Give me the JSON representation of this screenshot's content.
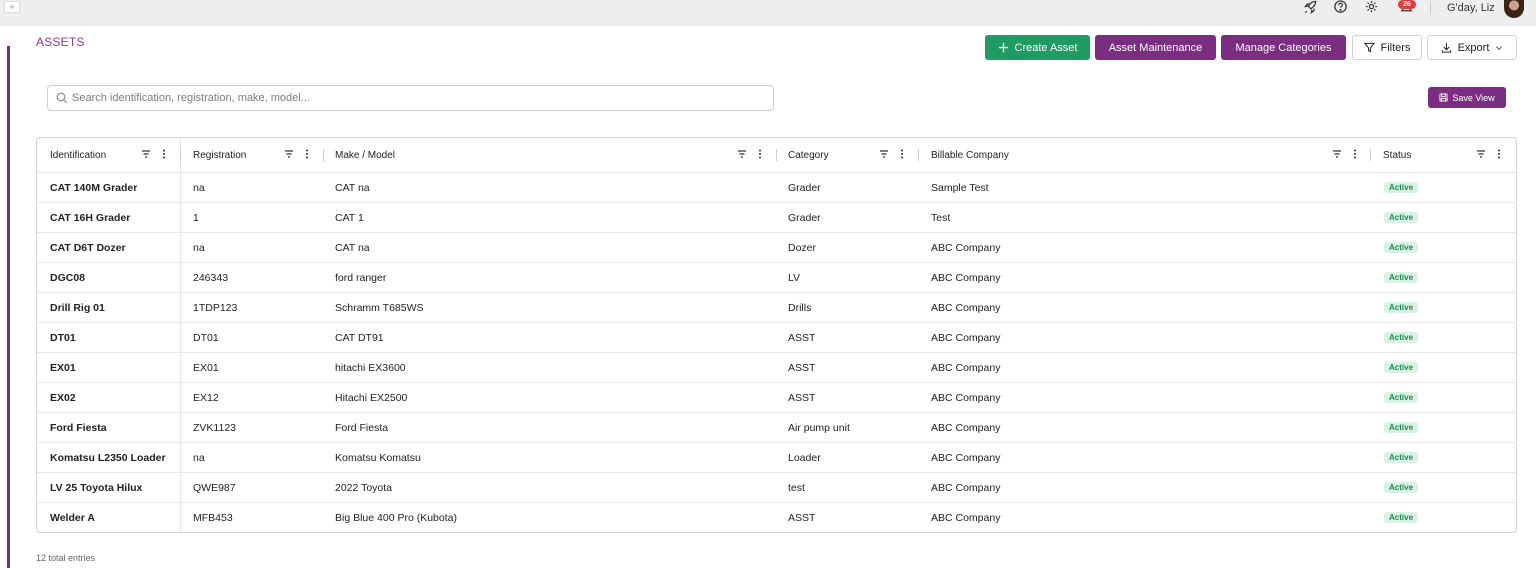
{
  "topbar": {
    "collapse_glyph": "«",
    "icons": [
      "rocket-icon",
      "help-icon",
      "gear-icon",
      "bell-icon"
    ],
    "notification_count": "26",
    "greeting": "G'day, Liz"
  },
  "page": {
    "title": "ASSETS"
  },
  "toolbar": {
    "create_label": "Create Asset",
    "maintenance_label": "Asset Maintenance",
    "categories_label": "Manage Categories",
    "filters_label": "Filters",
    "export_label": "Export"
  },
  "search": {
    "placeholder": "Search identification, registration, make, model...",
    "value": ""
  },
  "save_view": {
    "label": "Save View"
  },
  "table": {
    "columns": [
      "Identification",
      "Registration",
      "Make / Model",
      "Category",
      "Billable Company",
      "Status"
    ],
    "rows": [
      {
        "id": "CAT 140M Grader",
        "reg": "na",
        "make": "CAT na",
        "cat": "Grader",
        "bill": "Sample Test",
        "status": "Active"
      },
      {
        "id": "CAT 16H Grader",
        "reg": "1",
        "make": "CAT 1",
        "cat": "Grader",
        "bill": "Test",
        "status": "Active"
      },
      {
        "id": "CAT D6T Dozer",
        "reg": "na",
        "make": "CAT na",
        "cat": "Dozer",
        "bill": "ABC Company",
        "status": "Active"
      },
      {
        "id": "DGC08",
        "reg": "246343",
        "make": "ford ranger",
        "cat": "LV",
        "bill": "ABC Company",
        "status": "Active"
      },
      {
        "id": "Drill Rig 01",
        "reg": "1TDP123",
        "make": "Schramm T685WS",
        "cat": "Drills",
        "bill": "ABC Company",
        "status": "Active"
      },
      {
        "id": "DT01",
        "reg": "DT01",
        "make": "CAT DT91",
        "cat": "ASST",
        "bill": "ABC Company",
        "status": "Active"
      },
      {
        "id": "EX01",
        "reg": "EX01",
        "make": "hitachi EX3600",
        "cat": "ASST",
        "bill": "ABC Company",
        "status": "Active"
      },
      {
        "id": "EX02",
        "reg": "EX12",
        "make": "Hitachi EX2500",
        "cat": "ASST",
        "bill": "ABC Company",
        "status": "Active"
      },
      {
        "id": "Ford Fiesta",
        "reg": "ZVK1123",
        "make": "Ford Fiesta",
        "cat": "Air pump unit",
        "bill": "ABC Company",
        "status": "Active"
      },
      {
        "id": "Komatsu L2350 Loader",
        "reg": "na",
        "make": "Komatsu Komatsu",
        "cat": "Loader",
        "bill": "ABC Company",
        "status": "Active"
      },
      {
        "id": "LV 25 Toyota Hilux",
        "reg": "QWE987",
        "make": "2022 Toyota",
        "cat": "test",
        "bill": "ABC Company",
        "status": "Active"
      },
      {
        "id": "Welder A",
        "reg": "MFB453",
        "make": "Big Blue 400 Pro (Kubota)",
        "cat": "ASST",
        "bill": "ABC Company",
        "status": "Active"
      }
    ]
  },
  "footer": {
    "entries_text": "12 total entries"
  },
  "colors": {
    "brand_purple": "#7b2d82",
    "create_green": "#1f9b63",
    "status_active_bg": "#d8f3e4",
    "status_active_text": "#1a8a52"
  }
}
